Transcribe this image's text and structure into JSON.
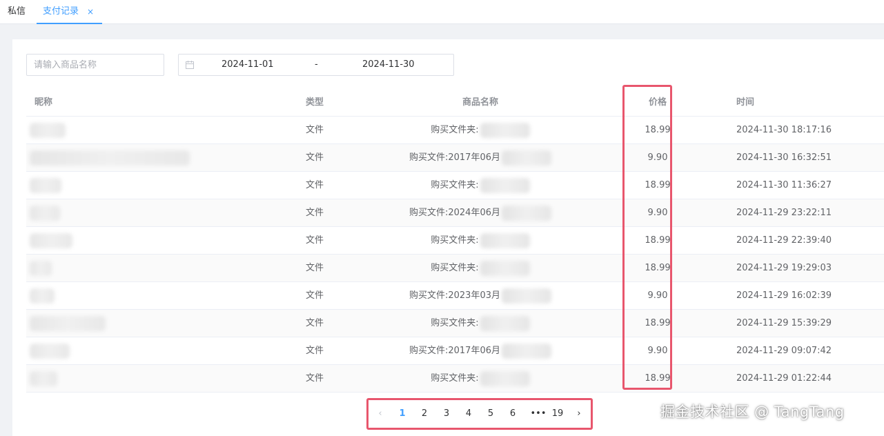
{
  "tabs": [
    {
      "label": "私信",
      "active": false
    },
    {
      "label": "支付记录",
      "active": true,
      "closable": true
    }
  ],
  "close_glyph": "×",
  "search": {
    "placeholder": "请输入商品名称",
    "value": ""
  },
  "date_range": {
    "icon": "calendar-icon",
    "start": "2024-11-01",
    "separator": "-",
    "end": "2024-11-30"
  },
  "table": {
    "columns": [
      "昵称",
      "类型",
      "商品名称",
      "价格",
      "时间"
    ],
    "rows": [
      {
        "nickname_blurred": true,
        "type": "文件",
        "product": "购买文件夹:",
        "price": "18.99",
        "time": "2024-11-30 18:17:16"
      },
      {
        "nickname_blurred": true,
        "type": "文件",
        "product": "购买文件:2017年06月",
        "price": "9.90",
        "time": "2024-11-30 16:32:51"
      },
      {
        "nickname_blurred": true,
        "type": "文件",
        "product": "购买文件夹:",
        "price": "18.99",
        "time": "2024-11-30 11:36:27"
      },
      {
        "nickname_blurred": true,
        "type": "文件",
        "product": "购买文件:2024年06月",
        "price": "9.90",
        "time": "2024-11-29 23:22:11"
      },
      {
        "nickname_blurred": true,
        "type": "文件",
        "product": "购买文件夹:",
        "price": "18.99",
        "time": "2024-11-29 22:39:40"
      },
      {
        "nickname_blurred": true,
        "type": "文件",
        "product": "购买文件夹:",
        "price": "18.99",
        "time": "2024-11-29 19:29:03"
      },
      {
        "nickname_blurred": true,
        "type": "文件",
        "product": "购买文件:2023年03月",
        "price": "9.90",
        "time": "2024-11-29 16:02:39"
      },
      {
        "nickname_blurred": true,
        "type": "文件",
        "product": "购买文件夹:",
        "price": "18.99",
        "time": "2024-11-29 15:39:29"
      },
      {
        "nickname_blurred": true,
        "type": "文件",
        "product": "购买文件:2017年06月",
        "price": "9.90",
        "time": "2024-11-29 09:07:42"
      },
      {
        "nickname_blurred": true,
        "type": "文件",
        "product": "购买文件夹:",
        "price": "18.99",
        "time": "2024-11-29 01:22:44"
      }
    ]
  },
  "pagination": {
    "prev": "‹",
    "next": "›",
    "pages": [
      "1",
      "2",
      "3",
      "4",
      "5",
      "6",
      "•••",
      "19"
    ],
    "current": "1"
  },
  "highlight_color": "#e8566d",
  "accent_color": "#409eff",
  "watermark": "掘金技术社区 @ TangTang"
}
